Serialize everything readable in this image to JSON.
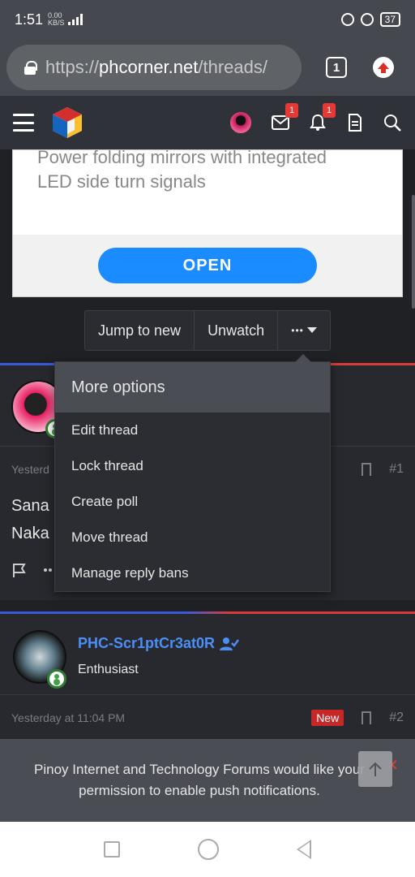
{
  "status_bar": {
    "time": "1:51",
    "network_speed_value": "0.00",
    "network_speed_unit": "KB/S",
    "battery": "37"
  },
  "browser": {
    "url_scheme": "https://",
    "url_host": "phcorner.net",
    "url_path": "/threads/",
    "tab_count": "1"
  },
  "site_header": {
    "messages_badge": "1",
    "alerts_badge": "1"
  },
  "ad": {
    "text_line1": "Power folding mirrors with integrated",
    "text_line2": "LED side turn signals",
    "button_label": "OPEN"
  },
  "thread_buttons": {
    "jump_label": "Jump to new",
    "unwatch_label": "Unwatch",
    "more_label": "•••"
  },
  "menu": {
    "title": "More options",
    "items": [
      {
        "label": "Edit thread"
      },
      {
        "label": "Lock thread"
      },
      {
        "label": "Create poll"
      },
      {
        "label": "Move thread"
      },
      {
        "label": "Manage reply bans"
      }
    ]
  },
  "post1": {
    "time_partial": "Yesterd",
    "post_number": "#1",
    "text_line1": "Sana",
    "text_line2": "Naka"
  },
  "post2": {
    "username": "PHC-Scr1ptCr3at0R",
    "user_title": "Enthusiast",
    "time": "Yesterday at 11:04 PM",
    "new_badge": "New",
    "post_number": "#2"
  },
  "push_banner": {
    "line1": "Pinoy Internet and Technology Forums would like your",
    "line2": "permission to enable push notifications.",
    "close": "✕"
  }
}
